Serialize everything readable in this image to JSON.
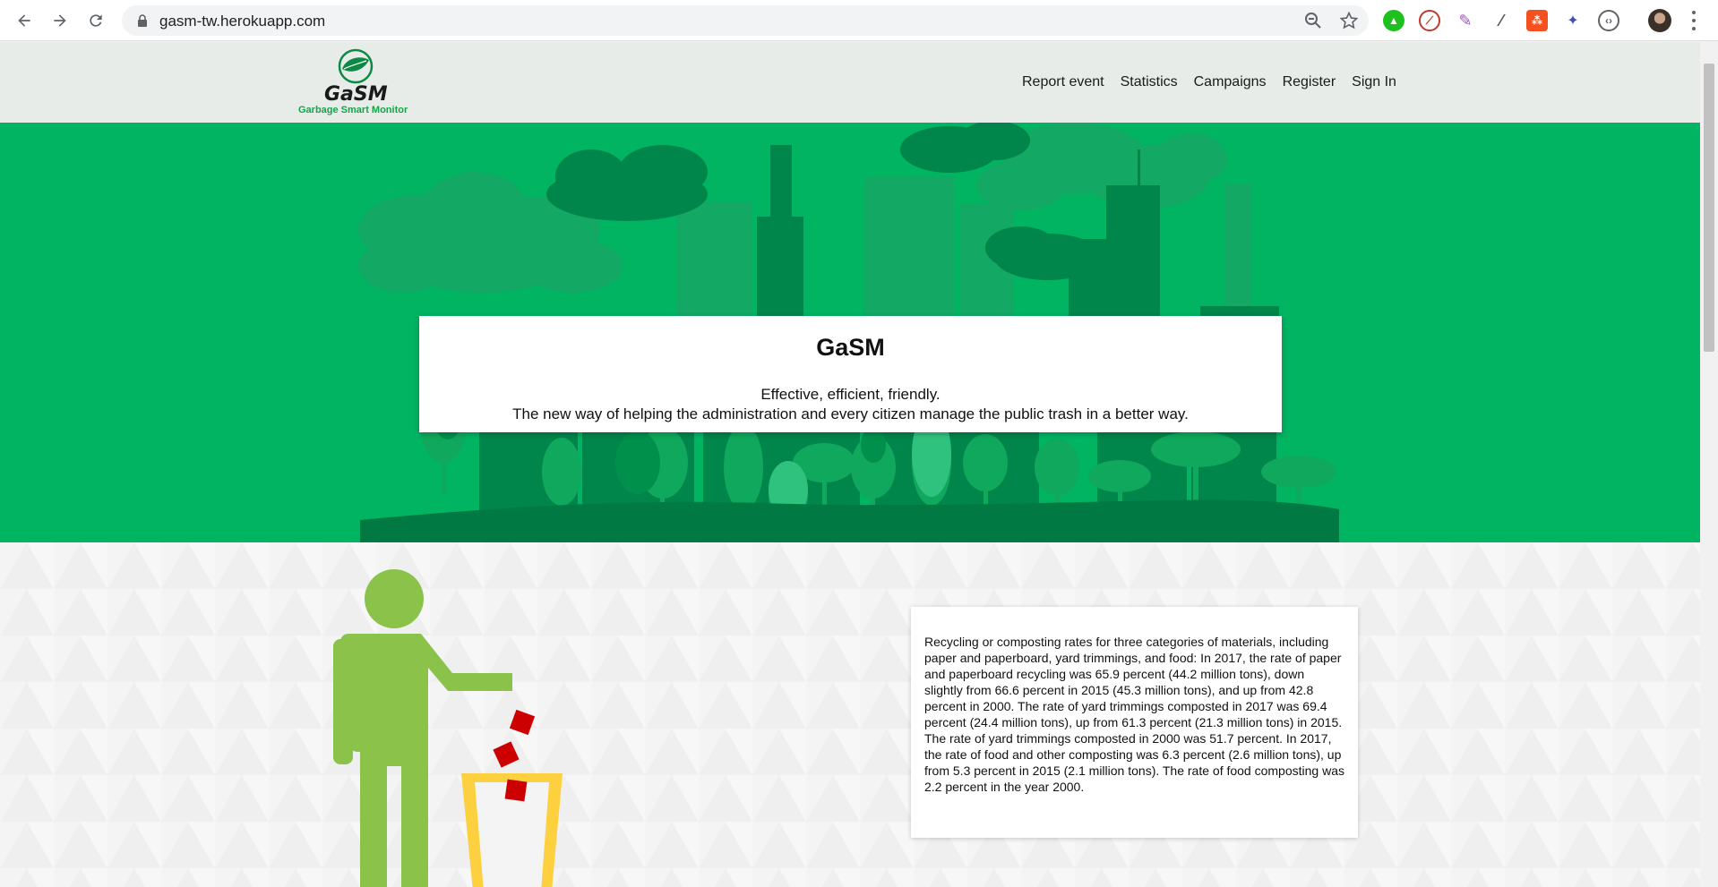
{
  "browser": {
    "url": "gasm-tw.herokuapp.com",
    "icons": [
      "back-arrow-icon",
      "forward-arrow-icon",
      "reload-icon",
      "lock-icon",
      "zoom-out-icon",
      "bookmark-star-icon",
      "extension-icons",
      "profile-avatar",
      "menu-dots-icon"
    ]
  },
  "header": {
    "logo_title": "GaSM",
    "logo_subtitle": "Garbage Smart Monitor",
    "nav": [
      "Report event",
      "Statistics",
      "Campaigns",
      "Register",
      "Sign In"
    ]
  },
  "hero": {
    "title": "GaSM",
    "line1": "Effective, efficient, friendly.",
    "line2": "The new way of helping the administration and every citizen manage the public trash in a better way."
  },
  "info": {
    "text": "Recycling or composting rates for three categories of materials, including paper and paperboard, yard trimmings, and food: In 2017, the rate of paper and paperboard recycling was 65.9 percent (44.2 million tons), down slightly from 66.6 percent in 2015 (45.3 million tons), and up from 42.8 percent in 2000. The rate of yard trimmings composted in 2017 was 69.4 percent (24.4 million tons), up from 61.3 percent (21.3 million tons) in 2015. The rate of yard trimmings composted in 2000 was 51.7 percent. In 2017, the rate of food and other composting was 6.3 percent (2.6 million tons), up from 5.3 percent in 2015 (2.1 million tons). The rate of food composting was 2.2 percent in the year 2000."
  },
  "colors": {
    "hero_green": "#00b462",
    "dark_green": "#00854a",
    "header_bg": "#e7ece9",
    "person_green": "#8bc34a",
    "bin_yellow": "#fdd03f",
    "trash_red": "#cc0000"
  }
}
